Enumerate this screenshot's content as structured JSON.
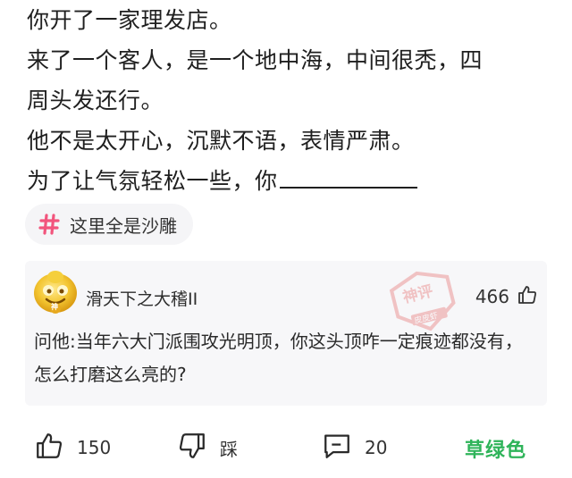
{
  "post": {
    "lines": [
      "你开了一家理发店。",
      "来了一个客人，是一个地中海，中间很秃，四",
      "周头发还行。",
      "他不是太开心，沉默不语，表情严肃。",
      "为了让气氛轻松一些，你"
    ]
  },
  "topic": {
    "icon": "hash-icon",
    "label": "这里全是沙雕"
  },
  "comment": {
    "avatar_badge": "神",
    "username": "滑天下之大稽II",
    "likes": "466",
    "stamp": {
      "top": "神评",
      "bottom": "皮皮虾"
    },
    "text": "问他:当年六大门派围攻光明顶，你这头顶咋一定痕迹都没有，怎么打磨这么亮的?"
  },
  "actions": {
    "like_count": "150",
    "dislike_label": "踩",
    "comment_count": "20"
  },
  "watermark": "草绿色",
  "colors": {
    "accent_pink": "#f2557d",
    "watermark_green": "#2fb45a",
    "card_bg": "#f7f7f9"
  }
}
